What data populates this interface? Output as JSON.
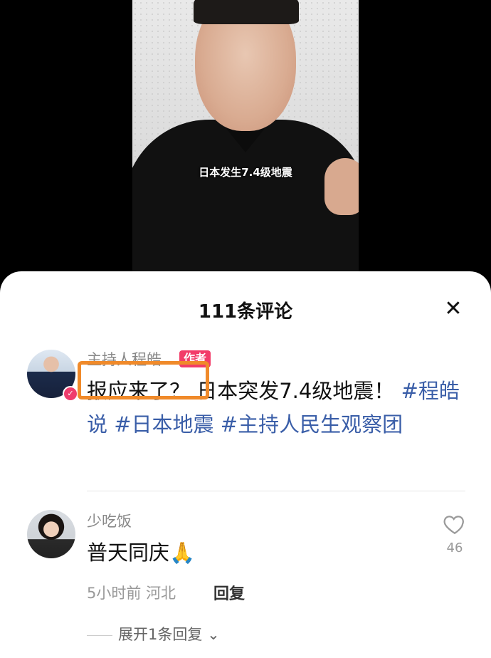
{
  "video": {
    "caption": "日本发生7.4级地震"
  },
  "comments_sheet": {
    "title": "111条评论",
    "close_icon": "close-icon"
  },
  "post": {
    "author_name": "主持人程皓",
    "author_tag": "作者",
    "highlighted_text": "报应来了？",
    "text_rest": "日本突发7.4级地震！",
    "hashtags": [
      "#程皓说",
      "#日本地震",
      "#主持人民生观察团"
    ]
  },
  "comments": [
    {
      "username": "少吃饭",
      "text": "普天同庆",
      "emoji": "🙏",
      "time": "5小时前",
      "location": "河北",
      "reply_label": "回复",
      "likes": "46",
      "expand_label": "展开1条回复"
    }
  ],
  "colors": {
    "accent_pink": "#f23c69",
    "hashtag_blue": "#3a5ea8",
    "highlight_orange": "#f08a2a"
  }
}
